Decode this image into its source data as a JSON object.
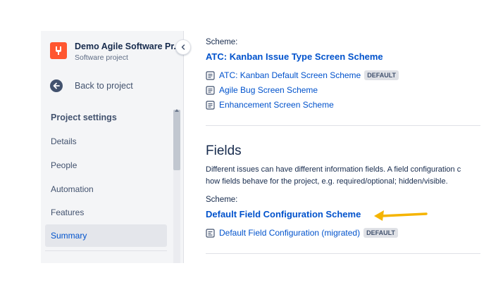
{
  "sidebar": {
    "project_name": "Demo Agile Software Pr...",
    "project_type": "Software project",
    "back_label": "Back to project",
    "section_title": "Project settings",
    "items": [
      {
        "label": "Details",
        "active": false
      },
      {
        "label": "People",
        "active": false
      },
      {
        "label": "Automation",
        "active": false
      },
      {
        "label": "Features",
        "active": false
      },
      {
        "label": "Summary",
        "active": true
      }
    ]
  },
  "screens": {
    "scheme_label": "Scheme:",
    "scheme_name": "ATC: Kanban Issue Type Screen Scheme",
    "items": [
      {
        "label": "ATC: Kanban Default Screen Scheme",
        "badge": "DEFAULT"
      },
      {
        "label": "Agile Bug Screen Scheme"
      },
      {
        "label": "Enhancement Screen Scheme"
      }
    ]
  },
  "fields": {
    "title": "Fields",
    "description_line1": "Different issues can have different information fields. A field configuration c",
    "description_line2": "how fields behave for the project, e.g. required/optional; hidden/visible.",
    "scheme_label": "Scheme:",
    "scheme_name": "Default Field Configuration Scheme",
    "items": [
      {
        "label": "Default Field Configuration (migrated)",
        "badge": "DEFAULT"
      }
    ]
  },
  "colors": {
    "link": "#0052cc",
    "annotation_arrow": "#f5b400",
    "project_avatar": "#ff5630"
  }
}
